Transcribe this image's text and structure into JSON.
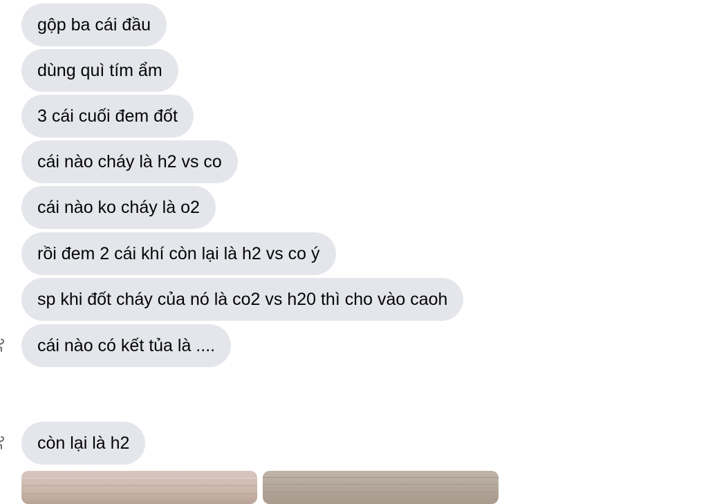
{
  "messages": [
    {
      "text": "gộp ba cái đầu"
    },
    {
      "text": "dùng quì tím ẩm"
    },
    {
      "text": "3 cái cuối đem đốt"
    },
    {
      "text": "cái nào cháy là h2 vs co"
    },
    {
      "text": "cái nào ko cháy là o2"
    },
    {
      "text": "rồi đem 2 cái khí còn lại là h2 vs co ý"
    },
    {
      "text": "sp khi đốt cháy của nó là co2 vs h20 thì cho vào caoh"
    },
    {
      "text": "cái nào có kết tủa là ...."
    },
    {
      "text": "còn lại là h2"
    }
  ],
  "attachments": [
    {
      "kind": "image"
    },
    {
      "kind": "image"
    }
  ],
  "colors": {
    "bubble_background": "#e4e6eb",
    "bubble_text": "#050505",
    "page_background": "#ffffff"
  },
  "icons": {
    "avatar_fragment": "avatar-fragment-icon"
  }
}
